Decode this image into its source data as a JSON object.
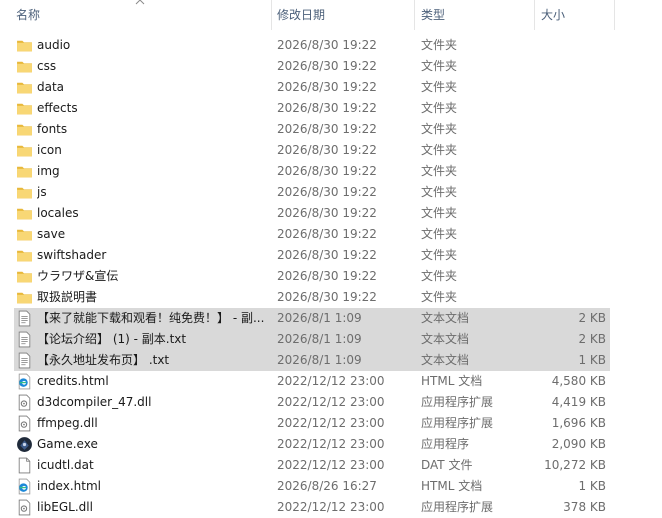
{
  "columns": {
    "name": "名称",
    "date": "修改日期",
    "type": "类型",
    "size": "大小"
  },
  "rows": [
    {
      "icon": "folder-icon",
      "name": "audio",
      "date": "2026/8/30 19:22",
      "type": "文件夹",
      "size": ""
    },
    {
      "icon": "folder-icon",
      "name": "css",
      "date": "2026/8/30 19:22",
      "type": "文件夹",
      "size": ""
    },
    {
      "icon": "folder-icon",
      "name": "data",
      "date": "2026/8/30 19:22",
      "type": "文件夹",
      "size": ""
    },
    {
      "icon": "folder-icon",
      "name": "effects",
      "date": "2026/8/30 19:22",
      "type": "文件夹",
      "size": ""
    },
    {
      "icon": "folder-icon",
      "name": "fonts",
      "date": "2026/8/30 19:22",
      "type": "文件夹",
      "size": ""
    },
    {
      "icon": "folder-icon",
      "name": "icon",
      "date": "2026/8/30 19:22",
      "type": "文件夹",
      "size": ""
    },
    {
      "icon": "folder-icon",
      "name": "img",
      "date": "2026/8/30 19:22",
      "type": "文件夹",
      "size": ""
    },
    {
      "icon": "folder-icon",
      "name": "js",
      "date": "2026/8/30 19:22",
      "type": "文件夹",
      "size": ""
    },
    {
      "icon": "folder-icon",
      "name": "locales",
      "date": "2026/8/30 19:22",
      "type": "文件夹",
      "size": ""
    },
    {
      "icon": "folder-icon",
      "name": "save",
      "date": "2026/8/30 19:22",
      "type": "文件夹",
      "size": ""
    },
    {
      "icon": "folder-icon",
      "name": "swiftshader",
      "date": "2026/8/30 19:22",
      "type": "文件夹",
      "size": ""
    },
    {
      "icon": "folder-icon",
      "name": "ウラワザ&宣伝",
      "date": "2026/8/30 19:22",
      "type": "文件夹",
      "size": ""
    },
    {
      "icon": "folder-icon",
      "name": "取扱説明書",
      "date": "2026/8/30 19:22",
      "type": "文件夹",
      "size": ""
    },
    {
      "icon": "text-file-icon",
      "name": "【来了就能下载和观看！纯免费！】 - 副...",
      "date": "2026/8/1 1:09",
      "type": "文本文档",
      "size": "2 KB",
      "selected": true
    },
    {
      "icon": "text-file-icon",
      "name": "【论坛介绍】 (1) - 副本.txt",
      "date": "2026/8/1 1:09",
      "type": "文本文档",
      "size": "2 KB",
      "selected": true
    },
    {
      "icon": "text-file-icon",
      "name": "【永久地址发布页】 .txt",
      "date": "2026/8/1 1:09",
      "type": "文本文档",
      "size": "1 KB",
      "selected": true
    },
    {
      "icon": "edge-html-icon",
      "name": "credits.html",
      "date": "2022/12/12 23:00",
      "type": "HTML 文档",
      "size": "4,580 KB"
    },
    {
      "icon": "dll-file-icon",
      "name": "d3dcompiler_47.dll",
      "date": "2022/12/12 23:00",
      "type": "应用程序扩展",
      "size": "4,419 KB"
    },
    {
      "icon": "dll-file-icon",
      "name": "ffmpeg.dll",
      "date": "2022/12/12 23:00",
      "type": "应用程序扩展",
      "size": "1,696 KB"
    },
    {
      "icon": "game-exe-icon",
      "name": "Game.exe",
      "date": "2022/12/12 23:00",
      "type": "应用程序",
      "size": "2,090 KB"
    },
    {
      "icon": "blank-file-icon",
      "name": "icudtl.dat",
      "date": "2022/12/12 23:00",
      "type": "DAT 文件",
      "size": "10,272 KB"
    },
    {
      "icon": "edge-html-icon",
      "name": "index.html",
      "date": "2026/8/26 16:27",
      "type": "HTML 文档",
      "size": "1 KB"
    },
    {
      "icon": "dll-file-icon",
      "name": "libEGL.dll",
      "date": "2022/12/12 23:00",
      "type": "应用程序扩展",
      "size": "378 KB"
    }
  ]
}
